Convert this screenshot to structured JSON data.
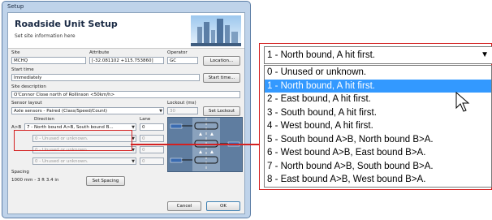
{
  "window": {
    "title": "Setup"
  },
  "banner": {
    "title": "Roadside Unit Setup",
    "subtitle": "Set site information here"
  },
  "site": {
    "label": "Site",
    "value": "MCHQ"
  },
  "attribute": {
    "label": "Attribute",
    "value": "[-32.081102 +115.753860]"
  },
  "operator": {
    "label": "Operator",
    "value": "GC"
  },
  "location_button": "Location...",
  "start_time": {
    "label": "Start time",
    "value": "Immediately",
    "button": "Start time..."
  },
  "site_description": {
    "label": "Site description",
    "value": "O'Connor Close north of Rollinson <50km/h>"
  },
  "sensor_layout": {
    "label": "Sensor layout",
    "value": "Axle sensors - Paired (Class/Speed/Count)"
  },
  "lockout": {
    "label": "Lockout (ms)",
    "value": "30",
    "button": "Set Lockout"
  },
  "direction_label": "Direction",
  "lane_label": "Lane",
  "rows": [
    {
      "prefix": "A>B",
      "direction": "7 - North bound A>B, South bound B...",
      "lane": "0"
    },
    {
      "prefix": "",
      "direction": "0 - Unused or unknown.",
      "lane": "0"
    },
    {
      "prefix": "",
      "direction": "0 - Unused or unknown.",
      "lane": "0"
    },
    {
      "prefix": "",
      "direction": "0 - Unused or unknown.",
      "lane": "0"
    }
  ],
  "spacing": {
    "label": "Spacing",
    "value": "1000 mm - 3 ft 3.4 in",
    "button": "Set Spacing"
  },
  "cancel_button": "Cancel",
  "ok_button": "OK",
  "dropdown": {
    "selected": "1 - North bound, A hit first.",
    "options": [
      "0 - Unused or unknown.",
      "1 - North bound, A hit first.",
      "2 - East bound, A hit first.",
      "3 - South bound, A hit first.",
      "4 - West bound, A hit first.",
      "5 - South bound A>B, North bound B>A.",
      "6 - West bound A>B, East bound B>A.",
      "7 - North bound A>B, South bound B>A.",
      "8 - East bound A>B, West bound B>A."
    ],
    "highlighted_index": 1
  },
  "colors": {
    "accent": "#3399ff",
    "annotation": "#d42020"
  }
}
